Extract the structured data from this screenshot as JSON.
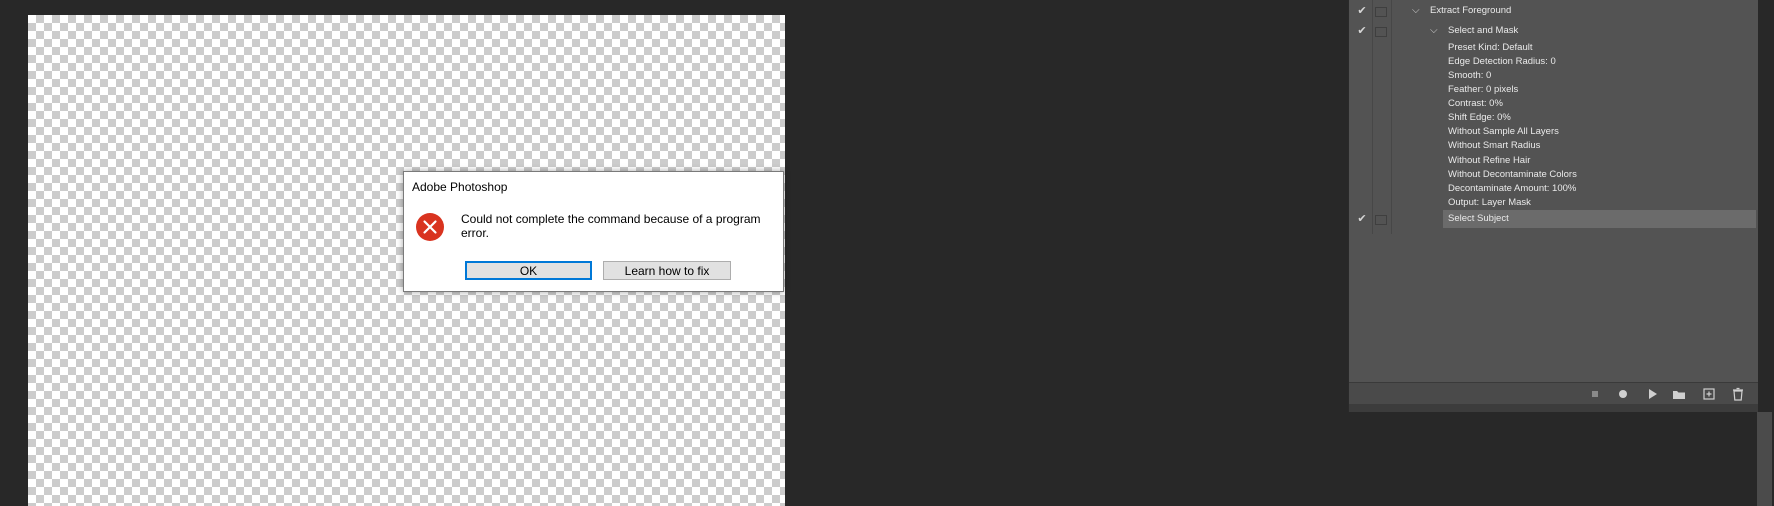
{
  "dialog": {
    "title": "Adobe Photoshop",
    "message": "Could not complete the command because of a program error.",
    "ok_label": "OK",
    "learn_label": "Learn how to fix",
    "icon": "error-icon"
  },
  "actions_panel": {
    "items": [
      {
        "label": "Extract Foreground",
        "checked": true,
        "expanded": true
      },
      {
        "label": "Select and Mask",
        "checked": true,
        "expanded": true
      },
      {
        "label": "Preset Kind: Default"
      },
      {
        "label": "Edge Detection Radius: 0"
      },
      {
        "label": "Smooth: 0"
      },
      {
        "label": "Feather: 0 pixels"
      },
      {
        "label": "Contrast: 0%"
      },
      {
        "label": "Shift Edge: 0%"
      },
      {
        "label": "Without Sample All Layers"
      },
      {
        "label": "Without Smart Radius"
      },
      {
        "label": "Without Refine Hair"
      },
      {
        "label": "Without Decontaminate Colors"
      },
      {
        "label": "Decontaminate Amount: 100%"
      },
      {
        "label": "Output: Layer Mask"
      },
      {
        "label": "Select Subject",
        "checked": true,
        "selected": true
      }
    ],
    "footer_icons": [
      "stop-icon",
      "record-icon",
      "play-icon",
      "new-set-icon",
      "new-action-icon",
      "delete-icon"
    ]
  },
  "colors": {
    "workspace": "#282828",
    "panel": "#535353",
    "error_red": "#d9331f",
    "focus_blue": "#0078d7"
  }
}
